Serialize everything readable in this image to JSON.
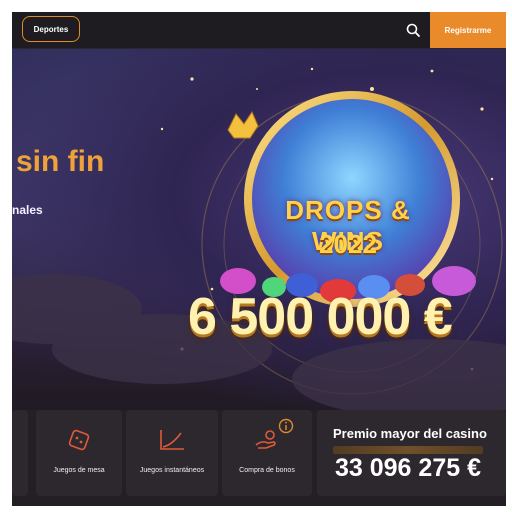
{
  "header": {
    "sports_label": "Deportes",
    "register_label": "Registrarme",
    "accent_color": "#e98a2b"
  },
  "hero": {
    "title": "sin fin",
    "subtitle": "nales",
    "promo_title": "DROPS & WINS",
    "promo_year": "2022",
    "promo_amount": "6 500 000 €"
  },
  "categories": [
    {
      "label": "",
      "icon": "partial-icon"
    },
    {
      "label": "Juegos de mesa",
      "icon": "dice-icon"
    },
    {
      "label": "Juegos instantáneos",
      "icon": "chart-icon"
    },
    {
      "label": "Compra de bonos",
      "icon": "hand-coins-icon",
      "badge_icon": "info-icon"
    }
  ],
  "jackpot": {
    "label": "Premio mayor del casino",
    "value": "33 096 275 €"
  }
}
